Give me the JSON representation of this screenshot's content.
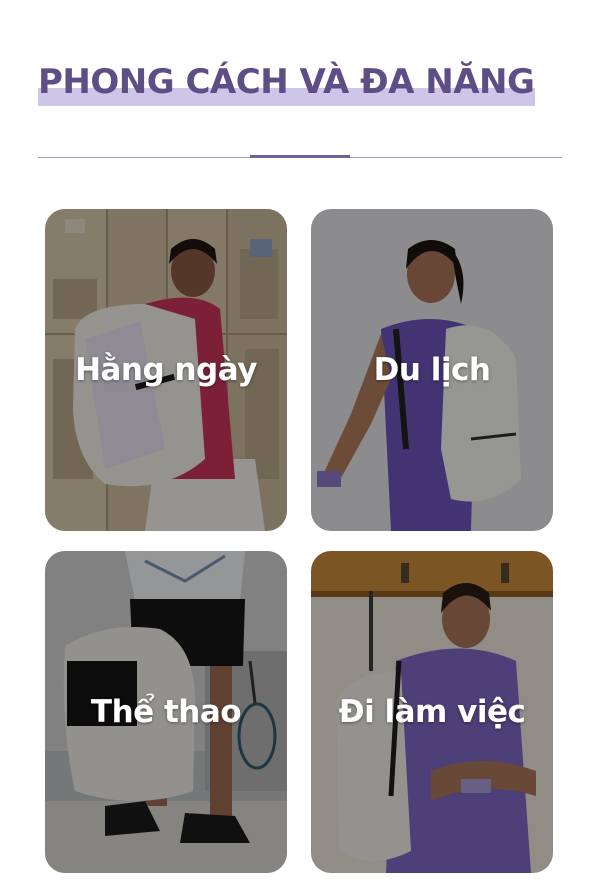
{
  "section": {
    "title": "PHONG CÁCH VÀ ĐA NĂNG"
  },
  "categories": [
    {
      "label": "Hằng ngày",
      "image": "girl-with-white-backpack-at-lockers"
    },
    {
      "label": "Du lịch",
      "image": "girl-purple-dress-white-backpack"
    },
    {
      "label": "Thể thao",
      "image": "person-holding-white-backpack-badminton"
    },
    {
      "label": "Đi làm việc",
      "image": "woman-purple-shirt-white-backpack-arms-crossed"
    }
  ],
  "colors": {
    "title": "#5e4e86",
    "title_highlight": "#cdc6e8",
    "divider": "#a59cc3",
    "accent": "#6f6196",
    "card_label": "#ffffff"
  }
}
